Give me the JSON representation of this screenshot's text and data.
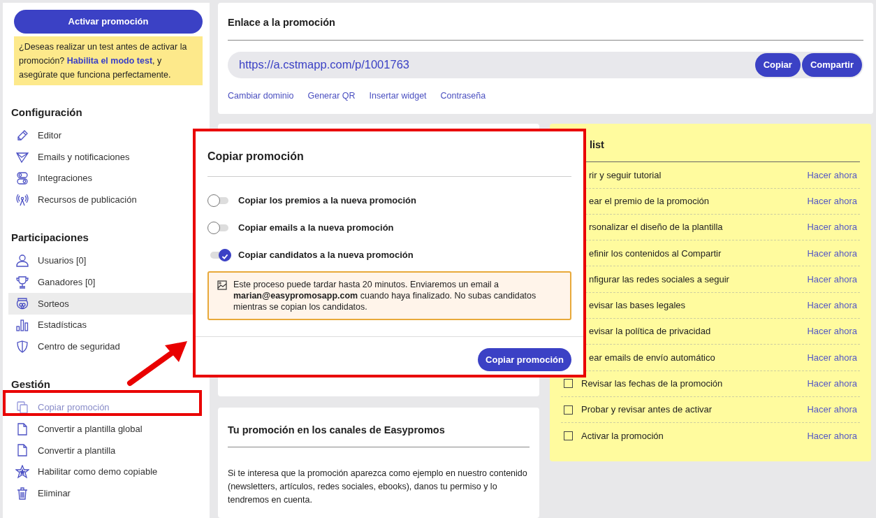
{
  "sidebar": {
    "activate_button": "Activar promoción",
    "test_notice": "¿Deseas realizar un test antes de activar la promoción? **Habilita el modo test**, y asegúrate que funciona perfectamente.",
    "sections": [
      {
        "title": "Configuración",
        "items": [
          {
            "label": "Editor",
            "selected": false,
            "disabled": false
          },
          {
            "label": "Emails y notificaciones",
            "selected": false,
            "disabled": false
          },
          {
            "label": "Integraciones",
            "selected": false,
            "disabled": false
          },
          {
            "label": "Recursos de publicación",
            "selected": false,
            "disabled": false
          }
        ]
      },
      {
        "title": "Participaciones",
        "items": [
          {
            "label": "Usuarios [0]",
            "selected": false,
            "disabled": false
          },
          {
            "label": "Ganadores [0]",
            "selected": false,
            "disabled": false
          },
          {
            "label": "Sorteos",
            "selected": true,
            "disabled": false
          },
          {
            "label": "Estadísticas",
            "selected": false,
            "disabled": false
          },
          {
            "label": "Centro de seguridad",
            "selected": false,
            "disabled": false
          }
        ]
      },
      {
        "title": "Gestión",
        "items": [
          {
            "label": "Copiar promoción",
            "selected": false,
            "disabled": true
          },
          {
            "label": "Convertir a plantilla global",
            "selected": false,
            "disabled": false
          },
          {
            "label": "Convertir a plantilla",
            "selected": false,
            "disabled": false
          },
          {
            "label": "Habilitar como demo copiable",
            "selected": false,
            "disabled": false
          },
          {
            "label": "Eliminar",
            "selected": false,
            "disabled": false
          }
        ]
      }
    ]
  },
  "link_card": {
    "title": "Enlace a la promoción",
    "url": "https://a.cstmapp.com/p/1001763",
    "buttons": [
      "Copiar",
      "Compartir"
    ],
    "links": [
      "Cambiar dominio",
      "Generar QR",
      "Insertar widget",
      "Contraseña"
    ]
  },
  "channels_card": {
    "title": "Tu promoción en los canales de Easypromos",
    "text": "Si te interesa que la promoción aparezca como ejemplo en nuestro contenido (newsletters, artículos, redes sociales, ebooks), danos tu permiso y lo tendremos en cuenta."
  },
  "todo_card": {
    "title": "list",
    "rows": [
      {
        "label": "rir y seguir tutorial",
        "action": "Hacer ahora"
      },
      {
        "label": "ear el premio de la promoción",
        "action": "Hacer ahora"
      },
      {
        "label": "rsonalizar el diseño de la plantilla",
        "action": "Hacer ahora"
      },
      {
        "label": "efinir los contenidos al Compartir",
        "action": "Hacer ahora"
      },
      {
        "label": "nfigurar las redes sociales a seguir",
        "action": "Hacer ahora"
      },
      {
        "label": "evisar las bases legales",
        "action": "Hacer ahora"
      },
      {
        "label": "evisar la política de privacidad",
        "action": "Hacer ahora"
      },
      {
        "label": "ear emails de envío automático",
        "action": "Hacer ahora"
      },
      {
        "label": "Revisar las fechas de la promoción",
        "action": "Hacer ahora",
        "checked": false
      },
      {
        "label": "Probar y revisar antes de activar",
        "action": "Hacer ahora",
        "checked": false
      },
      {
        "label": "Activar la promoción",
        "action": "Hacer ahora",
        "checked": false
      }
    ]
  },
  "dialog": {
    "title": "Copiar promoción",
    "options": [
      {
        "label": "Copiar los premios a la nueva promoción",
        "checked": false
      },
      {
        "label": "Copiar emails a la nueva promoción",
        "checked": false
      },
      {
        "label": "Copiar candidatos a la nueva promoción",
        "checked": true
      }
    ],
    "notice": "Este proceso puede tardar hasta 20 minutos. Enviaremos un email a **marian@easypromosapp.com** cuando haya finalizado. No subas candidatos mientras se copian los candidatos.",
    "confirm_button": "Copiar promoción"
  }
}
